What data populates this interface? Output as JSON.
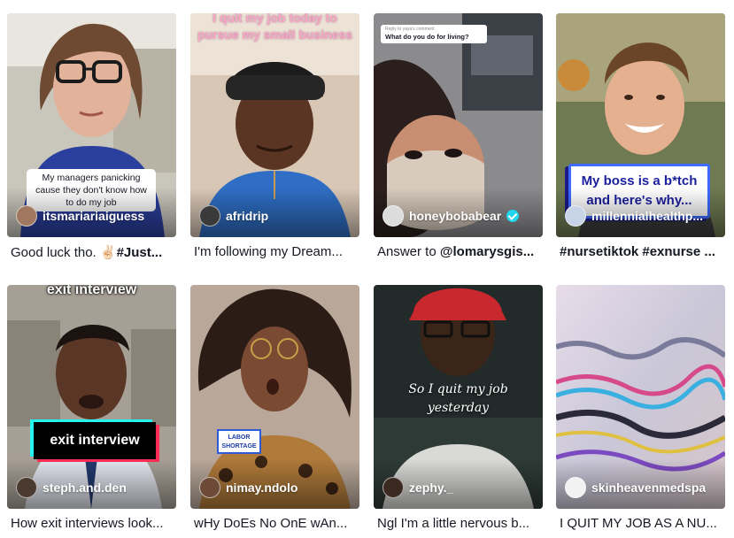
{
  "videos": [
    {
      "username": "itsmariariaiguess",
      "caption_text": "Good luck tho. ✌🏻",
      "caption_tag": "#Just...",
      "overlay": "My managers panicking cause they don't know how to do my job"
    },
    {
      "username": "afridrip",
      "caption_text": "I'm following my Dream...",
      "caption_tag": "",
      "overlay": "I quit my job today to pursue my small business"
    },
    {
      "username": "honeybobabear",
      "verified": true,
      "caption_text": "Answer to ",
      "caption_tag": "@lomarysgis...",
      "overlay_small": "Reply to yaya's comment",
      "overlay": "What do you do for living?"
    },
    {
      "username": "millennialhealthp...",
      "caption_text": "",
      "caption_tag": "#nursetiktok #exnurse ...",
      "overlay": "My boss is a b*tch and here's why..."
    },
    {
      "username": "steph.and.den",
      "caption_text": "How exit interviews look...",
      "caption_tag": "",
      "overlay_top": "exit interview",
      "overlay": "exit interview"
    },
    {
      "username": "nimay.ndolo",
      "caption_text": "wHy DoEs No OnE wAn...",
      "caption_tag": "",
      "overlay": "LABOR SHORTAGE"
    },
    {
      "username": "zephy._",
      "caption_text": "Ngl I'm a little nervous b...",
      "caption_tag": "",
      "overlay": "So I quit my job yesterday"
    },
    {
      "username": "skinheavenmedspa",
      "caption_text": "I QUIT MY JOB AS A NU...",
      "caption_tag": "",
      "overlay": ""
    }
  ],
  "colors": {
    "verified_badge": "#20d5ec",
    "caption_text": "#161823",
    "boss_box_border": "#3d6bff",
    "exit_cyan": "#25f4ee",
    "exit_red": "#fe2c55"
  }
}
